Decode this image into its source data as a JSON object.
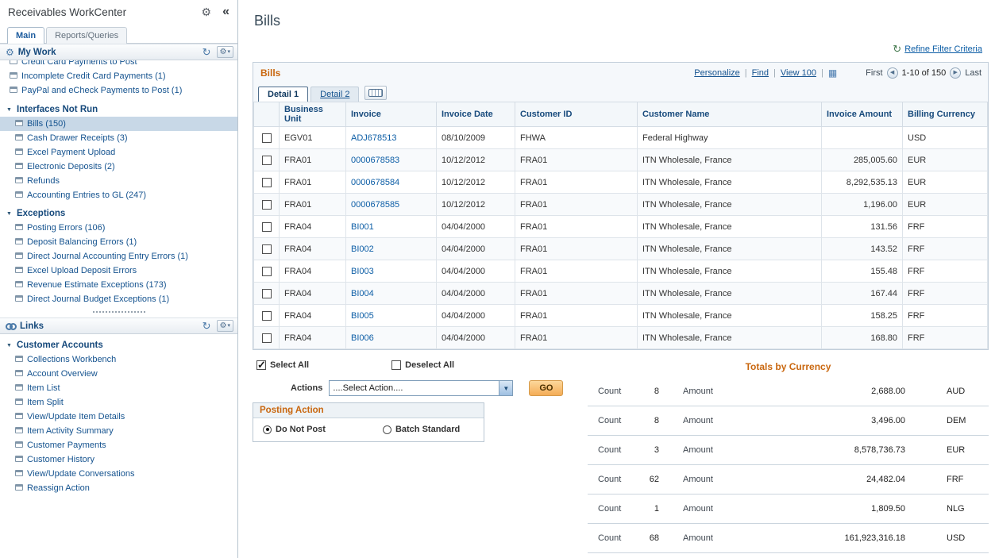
{
  "icons": {
    "gear": "⚙",
    "collapse": "«",
    "refresh": "↻",
    "caret_down": "▾",
    "triangle_down": "▼",
    "grid": "▦",
    "prev_arrow": "◀",
    "next_arrow": "▶",
    "combo_arrow": "▼"
  },
  "sidebar": {
    "title": "Receivables WorkCenter",
    "tabs": [
      {
        "label": "Main"
      },
      {
        "label": "Reports/Queries"
      }
    ],
    "my_work": {
      "header": "My Work",
      "top_items": [
        {
          "label": "Credit Card Payments to Post",
          "clipped": true
        },
        {
          "label": "Incomplete Credit Card Payments (1)"
        },
        {
          "label": "PayPal and eCheck Payments to Post (1)"
        }
      ],
      "interfaces_group": {
        "label": "Interfaces Not Run",
        "items": [
          {
            "label": "Bills (150)",
            "selected": true
          },
          {
            "label": "Cash Drawer Receipts (3)"
          },
          {
            "label": "Excel Payment Upload"
          },
          {
            "label": "Electronic Deposits (2)"
          },
          {
            "label": "Refunds"
          },
          {
            "label": "Accounting Entries to GL (247)"
          }
        ]
      },
      "exceptions_group": {
        "label": "Exceptions",
        "items": [
          {
            "label": "Posting Errors (106)"
          },
          {
            "label": "Deposit Balancing Errors (1)"
          },
          {
            "label": "Direct Journal Accounting Entry Errors (1)"
          },
          {
            "label": "Excel Upload Deposit Errors"
          },
          {
            "label": "Revenue Estimate Exceptions (173)"
          },
          {
            "label": "Direct Journal Budget Exceptions (1)"
          }
        ]
      }
    },
    "links": {
      "header": "Links",
      "customer_accounts_group": {
        "label": "Customer Accounts",
        "items": [
          {
            "label": "Collections Workbench"
          },
          {
            "label": "Account Overview"
          },
          {
            "label": "Item List"
          },
          {
            "label": "Item Split"
          },
          {
            "label": "View/Update Item Details"
          },
          {
            "label": "Item Activity Summary"
          },
          {
            "label": "Customer Payments"
          },
          {
            "label": "Customer History"
          },
          {
            "label": "View/Update Conversations"
          },
          {
            "label": "Reassign Action"
          }
        ]
      }
    }
  },
  "main": {
    "page_title": "Bills",
    "refine_link": "Refine Filter Criteria",
    "grid": {
      "title": "Bills",
      "toolbar": {
        "personalize": "Personalize",
        "find": "Find",
        "view": "View 100",
        "sep": "|"
      },
      "pager": {
        "first": "First",
        "range": "1-10 of 150",
        "last": "Last"
      },
      "tabs": [
        "Detail 1",
        "Detail 2"
      ],
      "columns": [
        "Business Unit",
        "Invoice",
        "Invoice Date",
        "Customer ID",
        "Customer Name",
        "Invoice Amount",
        "Billing Currency"
      ],
      "rows": [
        {
          "business_unit": "EGV01",
          "invoice": "ADJ678513",
          "invoice_date": "08/10/2009",
          "customer_id": "FHWA",
          "customer_name": "Federal Highway",
          "invoice_amount": "",
          "currency": "USD"
        },
        {
          "business_unit": "FRA01",
          "invoice": "0000678583",
          "invoice_date": "10/12/2012",
          "customer_id": "FRA01",
          "customer_name": "ITN Wholesale, France",
          "invoice_amount": "285,005.60",
          "currency": "EUR"
        },
        {
          "business_unit": "FRA01",
          "invoice": "0000678584",
          "invoice_date": "10/12/2012",
          "customer_id": "FRA01",
          "customer_name": "ITN Wholesale, France",
          "invoice_amount": "8,292,535.13",
          "currency": "EUR"
        },
        {
          "business_unit": "FRA01",
          "invoice": "0000678585",
          "invoice_date": "10/12/2012",
          "customer_id": "FRA01",
          "customer_name": "ITN Wholesale, France",
          "invoice_amount": "1,196.00",
          "currency": "EUR"
        },
        {
          "business_unit": "FRA04",
          "invoice": "BI001",
          "invoice_date": "04/04/2000",
          "customer_id": "FRA01",
          "customer_name": "ITN Wholesale, France",
          "invoice_amount": "131.56",
          "currency": "FRF"
        },
        {
          "business_unit": "FRA04",
          "invoice": "BI002",
          "invoice_date": "04/04/2000",
          "customer_id": "FRA01",
          "customer_name": "ITN Wholesale, France",
          "invoice_amount": "143.52",
          "currency": "FRF"
        },
        {
          "business_unit": "FRA04",
          "invoice": "BI003",
          "invoice_date": "04/04/2000",
          "customer_id": "FRA01",
          "customer_name": "ITN Wholesale, France",
          "invoice_amount": "155.48",
          "currency": "FRF"
        },
        {
          "business_unit": "FRA04",
          "invoice": "BI004",
          "invoice_date": "04/04/2000",
          "customer_id": "FRA01",
          "customer_name": "ITN Wholesale, France",
          "invoice_amount": "167.44",
          "currency": "FRF"
        },
        {
          "business_unit": "FRA04",
          "invoice": "BI005",
          "invoice_date": "04/04/2000",
          "customer_id": "FRA01",
          "customer_name": "ITN Wholesale, France",
          "invoice_amount": "158.25",
          "currency": "FRF"
        },
        {
          "business_unit": "FRA04",
          "invoice": "BI006",
          "invoice_date": "04/04/2000",
          "customer_id": "FRA01",
          "customer_name": "ITN Wholesale, France",
          "invoice_amount": "168.80",
          "currency": "FRF"
        }
      ]
    },
    "selection": {
      "select_all": {
        "label": "Select All",
        "checked": true
      },
      "deselect_all": {
        "label": "Deselect All",
        "checked": false
      }
    },
    "actions": {
      "label": "Actions",
      "value": "....Select Action....",
      "go": "GO"
    },
    "posting_action": {
      "title": "Posting Action",
      "options": [
        {
          "label": "Do Not Post",
          "selected": true
        },
        {
          "label": "Batch Standard",
          "selected": false
        }
      ]
    },
    "totals": {
      "title": "Totals by Currency",
      "count_label": "Count",
      "amount_label": "Amount",
      "rows": [
        {
          "count": "8",
          "amount": "2,688.00",
          "currency": "AUD"
        },
        {
          "count": "8",
          "amount": "3,496.00",
          "currency": "DEM"
        },
        {
          "count": "3",
          "amount": "8,578,736.73",
          "currency": "EUR"
        },
        {
          "count": "62",
          "amount": "24,482.04",
          "currency": "FRF"
        },
        {
          "count": "1",
          "amount": "1,809.50",
          "currency": "NLG"
        },
        {
          "count": "68",
          "amount": "161,923,316.18",
          "currency": "USD"
        }
      ]
    }
  }
}
